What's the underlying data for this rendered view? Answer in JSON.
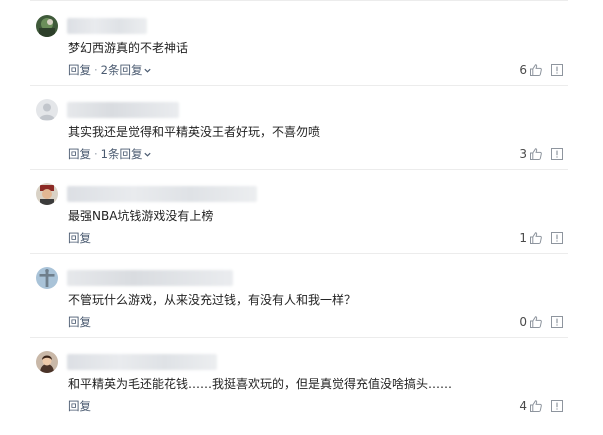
{
  "comments": [
    {
      "text": "梦幻西游真的不老神话",
      "reply_label": "回复",
      "separator": "·",
      "sub_replies_label": "2条回复",
      "likes": "6",
      "avatar_icon": "user-avatar-icon"
    },
    {
      "text": "其实我还是觉得和平精英没王者好玩，不喜勿喷",
      "reply_label": "回复",
      "separator": "·",
      "sub_replies_label": "1条回复",
      "likes": "3",
      "avatar_icon": "default-avatar-icon"
    },
    {
      "text": "最强NBA坑钱游戏没有上榜",
      "reply_label": "回复",
      "likes": "1",
      "avatar_icon": "user-avatar-icon"
    },
    {
      "text": "不管玩什么游戏，从来没充过钱，有没有人和我一样？",
      "reply_label": "回复",
      "likes": "0",
      "avatar_icon": "user-avatar-icon"
    },
    {
      "text": "和平精英为毛还能花钱……我挺喜欢玩的，但是真觉得充值没啥搞头……",
      "reply_label": "回复",
      "likes": "4",
      "avatar_icon": "user-avatar-icon"
    }
  ],
  "icons": {
    "like": "thumbs-up-icon",
    "report": "report-icon",
    "expand": "chevron-down-icon"
  },
  "colors": {
    "action_text": "#4a5a70",
    "icon_gray": "#8e959e",
    "divider": "#ececec"
  }
}
